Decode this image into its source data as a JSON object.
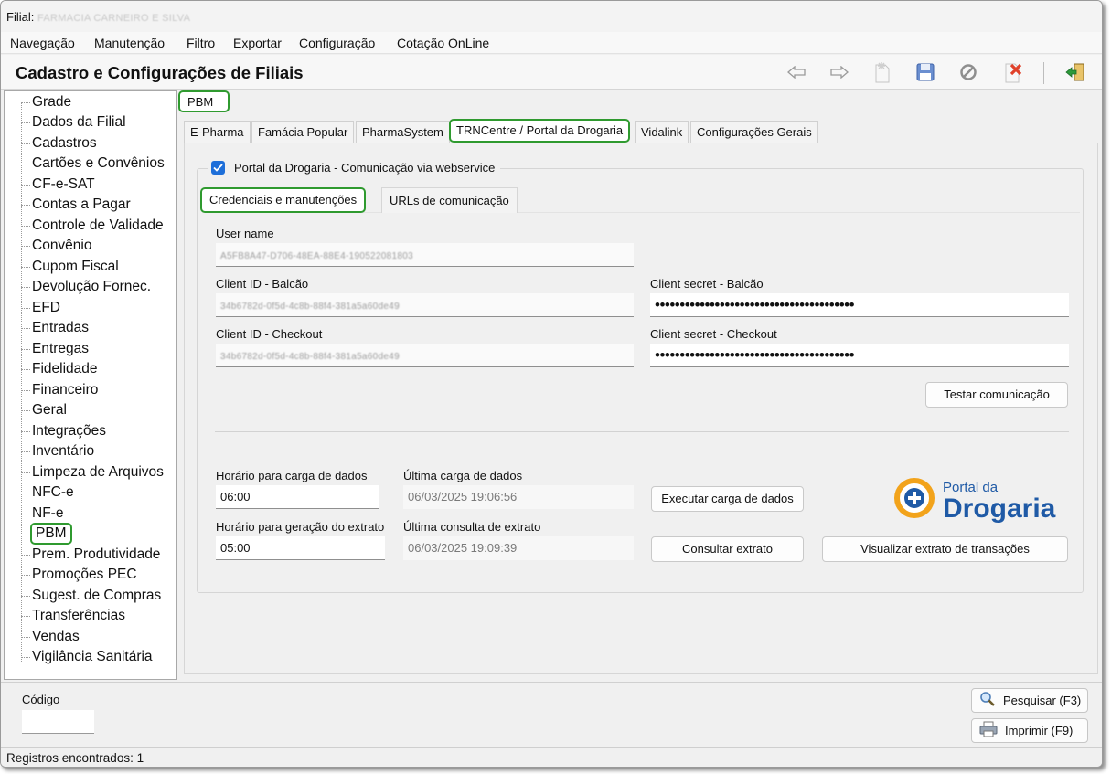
{
  "window": {
    "title_prefix": "Filial:",
    "title_branch": "FARMACIA CARNEIRO E SILVA"
  },
  "menu": [
    "Navegação",
    "Manutenção",
    "Filtro",
    "Exportar",
    "Configuração",
    "Cotação OnLine"
  ],
  "header": {
    "title": "Cadastro e Configurações de Filiais",
    "toolbar": [
      "back-arrow-icon",
      "forward-arrow-icon",
      "new-record-icon",
      "save-icon",
      "cancel-icon",
      "delete-icon",
      "exit-icon"
    ]
  },
  "tree": {
    "items": [
      "Grade",
      "Dados da Filial",
      "Cadastros",
      "Cartões e Convênios",
      "CF-e-SAT",
      "Contas a Pagar",
      "Controle de Validade",
      "Convênio",
      "Cupom Fiscal",
      "Devolução Fornec.",
      "EFD",
      "Entradas",
      "Entregas",
      "Fidelidade",
      "Financeiro",
      "Geral",
      "Integrações",
      "Inventário",
      "Limpeza de Arquivos",
      "NFC-e",
      "NF-e",
      "PBM",
      "Prem. Produtividade",
      "Promoções PEC",
      "Sugest. de Compras",
      "Transferências",
      "Vendas",
      "Vigilância Sanitária"
    ],
    "selected": "PBM"
  },
  "section_label": "PBM",
  "tabs": [
    "E-Pharma",
    "Famácia Popular",
    "PharmaSystem",
    "TRNCentre / Portal da Drogaria",
    "Vidalink",
    "Configurações Gerais"
  ],
  "active_tab": "TRNCentre / Portal da Drogaria",
  "portal": {
    "checkbox_label": "Portal da Drogaria - Comunicação via webservice",
    "checked": true,
    "subtabs": [
      "Credenciais e manutenções",
      "URLs de comunicação"
    ],
    "active_subtab": "Credenciais e manutenções",
    "user_name_label": "User name",
    "user_name_value": "A5FB8A47-D706-48EA-88E4-190522081803",
    "client_id_balcao_label": "Client ID - Balcão",
    "client_id_balcao_value": "34b6782d-0f5d-4c8b-88f4-381a5a60de49",
    "client_secret_balcao_label": "Client secret - Balcão",
    "client_secret_balcao_value": "••••••••••••••••••••••••••••••••••••••••",
    "client_id_checkout_label": "Client ID - Checkout",
    "client_id_checkout_value": "34b6782d-0f5d-4c8b-88f4-381a5a60de49",
    "client_secret_checkout_label": "Client secret - Checkout",
    "client_secret_checkout_value": "••••••••••••••••••••••••••••••••••••••••",
    "test_button": "Testar comunicação",
    "carga_label": "Horário para carga de dados",
    "carga_value": "06:00",
    "ultima_carga_label": "Última carga de dados",
    "ultima_carga_value": "06/03/2025 19:06:56",
    "executar_button": "Executar carga de dados",
    "extrato_label": "Horário para geração do extrato",
    "extrato_value": "05:00",
    "ultima_consulta_label": "Última consulta de extrato",
    "ultima_consulta_value": "06/03/2025 19:09:39",
    "consultar_button": "Consultar extrato",
    "visualizar_button": "Visualizar extrato de transações",
    "logo_small": "Portal da",
    "logo_big": "Drogaria"
  },
  "bottom": {
    "codigo_label": "Código",
    "codigo_value": "",
    "pesquisar_button": "Pesquisar (F3)",
    "imprimir_button": "Imprimir (F9)"
  },
  "status": "Registros encontrados: 1",
  "colors": {
    "highlight_green": "#2f9a2f",
    "checkbox_blue": "#1e6fd9",
    "logo_blue": "#1f5aa6",
    "logo_orange": "#f2a31b"
  }
}
